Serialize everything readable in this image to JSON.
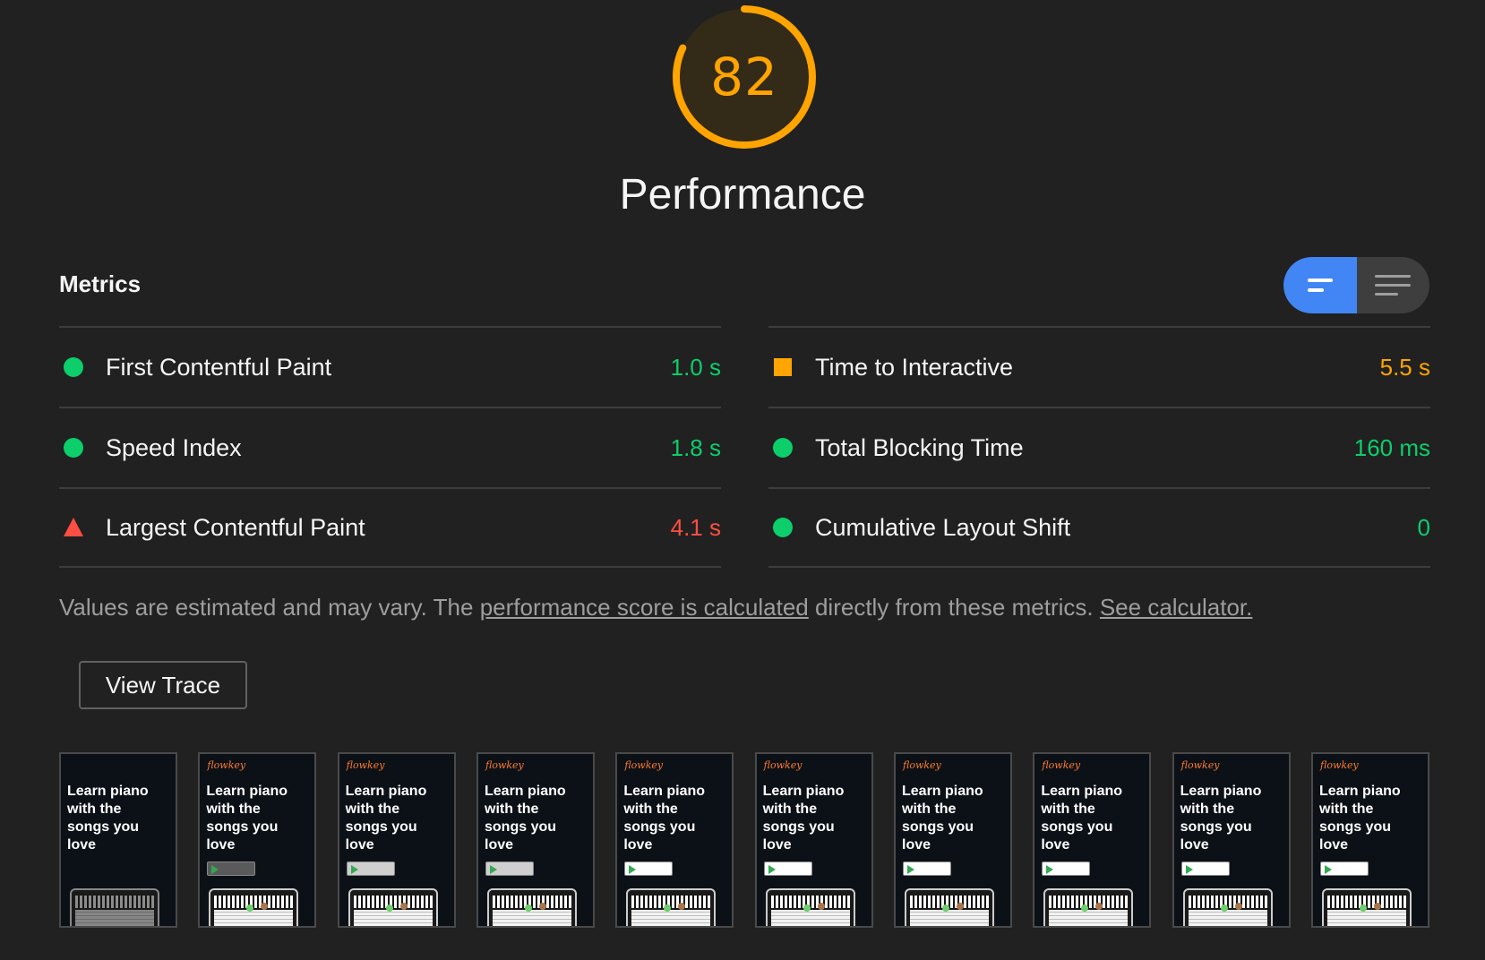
{
  "gauge": {
    "score": "82",
    "fraction": 0.82,
    "color": "#ffa400"
  },
  "category_title": "Performance",
  "metrics": {
    "header": "Metrics",
    "left": [
      {
        "icon": "pass-circle-icon",
        "title": "First Contentful Paint",
        "value": "1.0 s",
        "status": "pass"
      },
      {
        "icon": "pass-circle-icon",
        "title": "Speed Index",
        "value": "1.8 s",
        "status": "pass"
      },
      {
        "icon": "fail-triangle-icon",
        "title": "Largest Contentful Paint",
        "value": "4.1 s",
        "status": "fail"
      }
    ],
    "right": [
      {
        "icon": "average-square-icon",
        "title": "Time to Interactive",
        "value": "5.5 s",
        "status": "avg"
      },
      {
        "icon": "pass-circle-icon",
        "title": "Total Blocking Time",
        "value": "160 ms",
        "status": "pass"
      },
      {
        "icon": "pass-circle-icon",
        "title": "Cumulative Layout Shift",
        "value": "0",
        "status": "pass"
      }
    ]
  },
  "disclaimer": {
    "prefix": "Values are estimated and may vary. The ",
    "link1": "performance score is calculated",
    "middle": " directly from these metrics. ",
    "link2": "See calculator."
  },
  "view_trace_label": "View Trace",
  "filmstrip": {
    "logo_text": "flowkey",
    "headline": "Learn piano\nwith the\nsongs you\nlove",
    "frame_count": 10
  },
  "colors": {
    "pass": "#0cce6b",
    "average": "#ffa400",
    "fail": "#ff4e42",
    "toggle_active": "#4285f4",
    "background": "#212121"
  }
}
